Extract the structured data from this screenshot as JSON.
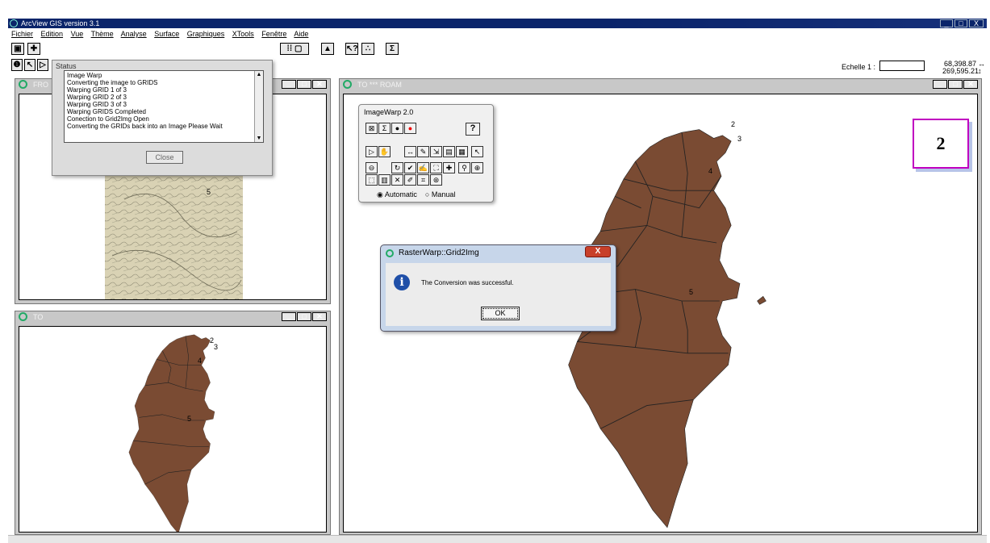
{
  "app": {
    "title": "ArcView GIS version 3.1",
    "window_controls": [
      "_",
      "□",
      "X"
    ]
  },
  "menu": [
    "Fichier",
    "Edition",
    "Vue",
    "Thème",
    "Analyse",
    "Surface",
    "Graphiques",
    "XTools",
    "Fenêtre",
    "Aide"
  ],
  "toolbar": {
    "scale_label": "Echelle 1 :",
    "scale_value": "",
    "coord_x": "68,398.87",
    "coord_y": "269,595.21"
  },
  "windows": {
    "from": {
      "title": "FRO"
    },
    "to": {
      "title": "TO"
    },
    "to_roam": {
      "title": "TO *** ROAM"
    }
  },
  "status_dialog": {
    "title": "Status",
    "lines": [
      "Image Warp",
      "Converting the image to GRIDS",
      "Warping GRID 1 of 3",
      "Warping GRID 2 of 3",
      "Warping GRID 3 of 3",
      "Warping GRIDS Completed",
      "Conection to Grid2Img Open",
      "Converting the GRIDs back into an Image Please Wait"
    ],
    "close_label": "Close"
  },
  "imagewarp": {
    "title": "ImageWarp 2.0",
    "help": "?",
    "mode_automatic": "Automatic",
    "mode_manual": "Manual",
    "selected_mode": "Automatic"
  },
  "message_box": {
    "title": "RasterWarp::Grid2Img",
    "message": "The Conversion was successful.",
    "ok_label": "OK"
  },
  "badge": {
    "number": "2"
  },
  "map_labels": {
    "l2": "2",
    "l3": "3",
    "l4": "4",
    "l5": "5"
  },
  "colors": {
    "map_fill": "#7a4b33",
    "title_bar": "#0a246a",
    "badge_border": "#c000c0"
  }
}
